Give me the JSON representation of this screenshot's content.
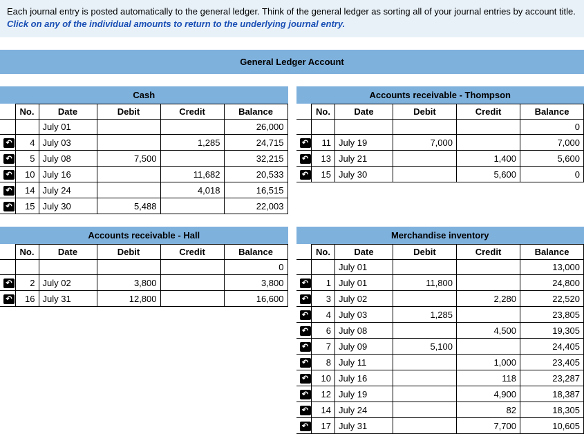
{
  "intro": {
    "text": "Each journal entry is posted automatically to the general ledger. Think of the general ledger as sorting all of your journal entries by account title. ",
    "hint": "Click on any of the individual amounts to return to the underlying journal entry."
  },
  "page_title": "General Ledger Account",
  "headers": {
    "no": "No.",
    "date": "Date",
    "debit": "Debit",
    "credit": "Credit",
    "balance": "Balance"
  },
  "ledgers": [
    {
      "title": "Cash",
      "side": "left",
      "rows": [
        {
          "link": false,
          "no": "",
          "date": "July 01",
          "debit": "",
          "credit": "",
          "balance": "26,000"
        },
        {
          "link": true,
          "no": "4",
          "date": "July 03",
          "debit": "",
          "credit": "1,285",
          "balance": "24,715"
        },
        {
          "link": true,
          "no": "5",
          "date": "July 08",
          "debit": "7,500",
          "credit": "",
          "balance": "32,215"
        },
        {
          "link": true,
          "no": "10",
          "date": "July 16",
          "debit": "",
          "credit": "11,682",
          "balance": "20,533"
        },
        {
          "link": true,
          "no": "14",
          "date": "July 24",
          "debit": "",
          "credit": "4,018",
          "balance": "16,515"
        },
        {
          "link": true,
          "no": "15",
          "date": "July 30",
          "debit": "5,488",
          "credit": "",
          "balance": "22,003"
        }
      ]
    },
    {
      "title": "Accounts receivable - Thompson",
      "side": "right",
      "rows": [
        {
          "link": false,
          "no": "",
          "date": "",
          "debit": "",
          "credit": "",
          "balance": "0"
        },
        {
          "link": true,
          "no": "11",
          "date": "July 19",
          "debit": "7,000",
          "credit": "",
          "balance": "7,000"
        },
        {
          "link": true,
          "no": "13",
          "date": "July 21",
          "debit": "",
          "credit": "1,400",
          "balance": "5,600"
        },
        {
          "link": true,
          "no": "15",
          "date": "July 30",
          "debit": "",
          "credit": "5,600",
          "balance": "0"
        }
      ]
    },
    {
      "title": "Accounts receivable - Hall",
      "side": "left",
      "rows": [
        {
          "link": false,
          "no": "",
          "date": "",
          "debit": "",
          "credit": "",
          "balance": "0"
        },
        {
          "link": true,
          "no": "2",
          "date": "July 02",
          "debit": "3,800",
          "credit": "",
          "balance": "3,800"
        },
        {
          "link": true,
          "no": "16",
          "date": "July 31",
          "debit": "12,800",
          "credit": "",
          "balance": "16,600"
        }
      ]
    },
    {
      "title": "Merchandise inventory",
      "side": "right",
      "rows": [
        {
          "link": false,
          "no": "",
          "date": "July 01",
          "debit": "",
          "credit": "",
          "balance": "13,000"
        },
        {
          "link": true,
          "no": "1",
          "date": "July 01",
          "debit": "11,800",
          "credit": "",
          "balance": "24,800"
        },
        {
          "link": true,
          "no": "3",
          "date": "July 02",
          "debit": "",
          "credit": "2,280",
          "balance": "22,520"
        },
        {
          "link": true,
          "no": "4",
          "date": "July 03",
          "debit": "1,285",
          "credit": "",
          "balance": "23,805"
        },
        {
          "link": true,
          "no": "6",
          "date": "July 08",
          "debit": "",
          "credit": "4,500",
          "balance": "19,305"
        },
        {
          "link": true,
          "no": "7",
          "date": "July 09",
          "debit": "5,100",
          "credit": "",
          "balance": "24,405"
        },
        {
          "link": true,
          "no": "8",
          "date": "July 11",
          "debit": "",
          "credit": "1,000",
          "balance": "23,405"
        },
        {
          "link": true,
          "no": "10",
          "date": "July 16",
          "debit": "",
          "credit": "118",
          "balance": "23,287"
        },
        {
          "link": true,
          "no": "12",
          "date": "July 19",
          "debit": "",
          "credit": "4,900",
          "balance": "18,387"
        },
        {
          "link": true,
          "no": "14",
          "date": "July 24",
          "debit": "",
          "credit": "82",
          "balance": "18,305"
        },
        {
          "link": true,
          "no": "17",
          "date": "July 31",
          "debit": "",
          "credit": "7,700",
          "balance": "10,605"
        }
      ]
    }
  ]
}
